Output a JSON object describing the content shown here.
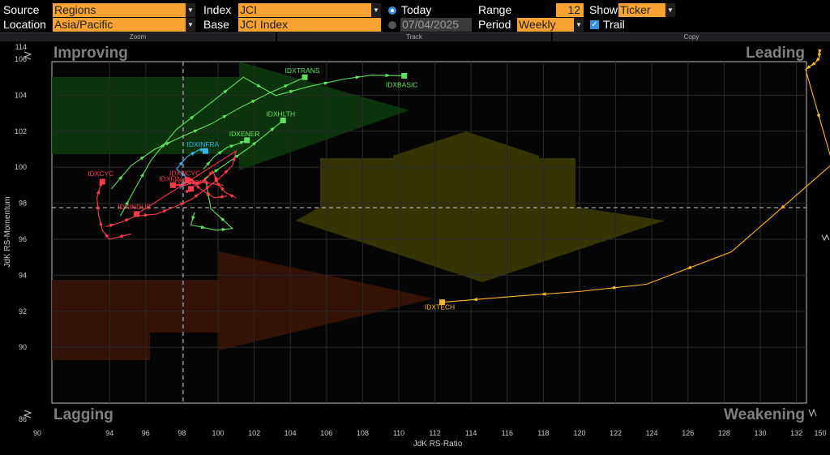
{
  "controls": {
    "source_label": "Source",
    "source_value": "Regions",
    "location_label": "Location",
    "location_value": "Asia/Pacific",
    "index_label": "Index",
    "index_value": "JCI",
    "base_label": "Base",
    "base_value": "JCI Index",
    "today_label": "Today",
    "date_value": "07/04/2025",
    "range_label": "Range",
    "range_value": "12",
    "period_label": "Period",
    "period_value": "Weekly",
    "show_label": "Show",
    "show_value": "Ticker",
    "trail_label": "Trail"
  },
  "sections": {
    "zoom": "Zoom",
    "track": "Track",
    "copy": "Copy"
  },
  "quadrants": {
    "improving": "Improving",
    "leading": "Leading",
    "lagging": "Lagging",
    "weakening": "Weakening"
  },
  "colors": {
    "green": "#5fe35f",
    "red": "#ff3b4e",
    "blue": "#36b7f0",
    "orange": "#ffb52e",
    "bg": "#000000",
    "accent": "#f7a233"
  },
  "chart_data": {
    "type": "scatter",
    "xlabel": "JdK RS-Ratio",
    "ylabel": "JdK RS-Momentum",
    "xlim": [
      90,
      150
    ],
    "ylim": [
      86,
      114
    ],
    "x_ticks_visible": [
      90,
      94,
      96,
      98,
      100,
      102,
      104,
      106,
      108,
      110,
      112,
      114,
      116,
      118,
      120,
      122,
      124,
      126,
      128,
      130,
      132,
      150
    ],
    "y_ticks_visible": [
      86,
      90,
      92,
      94,
      96,
      98,
      100,
      102,
      104,
      106,
      114
    ],
    "x_break": [
      134,
      150
    ],
    "y_break": [
      106,
      114
    ],
    "grid": true,
    "series": [
      {
        "name": "IDXBASIC",
        "color": "green",
        "points": [
          [
            94.6,
            97.3
          ],
          [
            95.4,
            98.8
          ],
          [
            96.3,
            100.4
          ],
          [
            97.7,
            102.1
          ],
          [
            99.5,
            103.5
          ],
          [
            101.4,
            105.0
          ],
          [
            103.2,
            106.4
          ],
          [
            105.0,
            107.8
          ],
          [
            107.0,
            109.0
          ],
          [
            108.5,
            109.6
          ],
          [
            110.3,
            109.5
          ]
        ]
      },
      {
        "name": "IDXTRANS",
        "color": "green",
        "points": [
          [
            94.1,
            98.8
          ],
          [
            95.2,
            100.1
          ],
          [
            96.5,
            101.0
          ],
          [
            98.0,
            101.7
          ],
          [
            99.6,
            102.4
          ],
          [
            101.2,
            103.3
          ],
          [
            102.8,
            104.1
          ],
          [
            104.8,
            105.0
          ]
        ]
      },
      {
        "name": "IDXHLTH",
        "color": "green",
        "points": [
          [
            98.7,
            97.5
          ],
          [
            98.5,
            96.8
          ],
          [
            99.9,
            96.5
          ],
          [
            100.8,
            96.6
          ],
          [
            99.6,
            97.7
          ],
          [
            99.3,
            99.4
          ],
          [
            100.6,
            100.3
          ],
          [
            101.6,
            101.0
          ],
          [
            102.5,
            101.7
          ],
          [
            103.6,
            102.6
          ]
        ]
      },
      {
        "name": "IDXENER",
        "color": "green",
        "points": [
          [
            99.2,
            99.9
          ],
          [
            99.8,
            100.6
          ],
          [
            100.5,
            101.1
          ],
          [
            101.1,
            101.3
          ],
          [
            101.6,
            101.5
          ]
        ]
      },
      {
        "name": "IDXINFRA",
        "color": "blue",
        "points": [
          [
            97.9,
            98.8
          ],
          [
            98.3,
            99.4
          ],
          [
            97.7,
            99.9
          ],
          [
            98.3,
            100.6
          ],
          [
            99.0,
            101.0
          ],
          [
            99.3,
            100.9
          ]
        ]
      },
      {
        "name": "IDXCYC",
        "color": "red",
        "points": [
          [
            95.2,
            96.3
          ],
          [
            94.0,
            96.0
          ],
          [
            93.6,
            96.5
          ],
          [
            93.4,
            97.3
          ],
          [
            93.3,
            98.3
          ],
          [
            93.5,
            99.0
          ],
          [
            93.6,
            99.2
          ]
        ]
      },
      {
        "name": "IDXINDUS",
        "color": "red",
        "points": [
          [
            93.8,
            96.7
          ],
          [
            94.5,
            96.9
          ],
          [
            95.5,
            97.3
          ],
          [
            96.6,
            97.4
          ],
          [
            97.6,
            97.8
          ],
          [
            98.5,
            98.2
          ],
          [
            99.2,
            98.7
          ],
          [
            99.7,
            99.1
          ],
          [
            100.2,
            99.5
          ],
          [
            100.8,
            100.1
          ],
          [
            101.0,
            100.9
          ],
          [
            95.5,
            97.4
          ]
        ]
      },
      {
        "name": "IDXNCYC",
        "color": "red",
        "points": [
          [
            100.5,
            98.4
          ],
          [
            99.8,
            98.3
          ],
          [
            99.0,
            98.8
          ],
          [
            98.7,
            99.1
          ],
          [
            98.6,
            99.3
          ],
          [
            98.3,
            99.3
          ]
        ]
      },
      {
        "name": "IDXFIN",
        "color": "red",
        "points": [
          [
            101.0,
            98.3
          ],
          [
            100.4,
            98.6
          ],
          [
            100.0,
            99.1
          ],
          [
            99.7,
            99.8
          ],
          [
            99.4,
            99.4
          ],
          [
            99.0,
            99.1
          ],
          [
            98.6,
            99.2
          ],
          [
            98.2,
            99.0
          ],
          [
            97.5,
            99.0
          ]
        ]
      },
      {
        "name": "IDXPROP",
        "color": "red",
        "points": [
          [
            100.3,
            99.0
          ],
          [
            99.6,
            99.1
          ],
          [
            99.0,
            99.2
          ],
          [
            98.6,
            98.9
          ],
          [
            98.2,
            98.6
          ],
          [
            98.5,
            98.8
          ]
        ]
      },
      {
        "name": "IDXTECH",
        "color": "orange",
        "points": [
          [
            149.5,
            113.5
          ],
          [
            149.2,
            113.0
          ],
          [
            148.9,
            112.3
          ],
          [
            145.0,
            111.5
          ],
          [
            140.0,
            111.0
          ],
          [
            135.5,
            110.5
          ],
          [
            134.0,
            100.2
          ],
          [
            128.4,
            95.3
          ],
          [
            123.7,
            93.5
          ],
          [
            120.0,
            93.1
          ],
          [
            116.0,
            92.8
          ],
          [
            112.4,
            92.5
          ]
        ]
      }
    ]
  }
}
